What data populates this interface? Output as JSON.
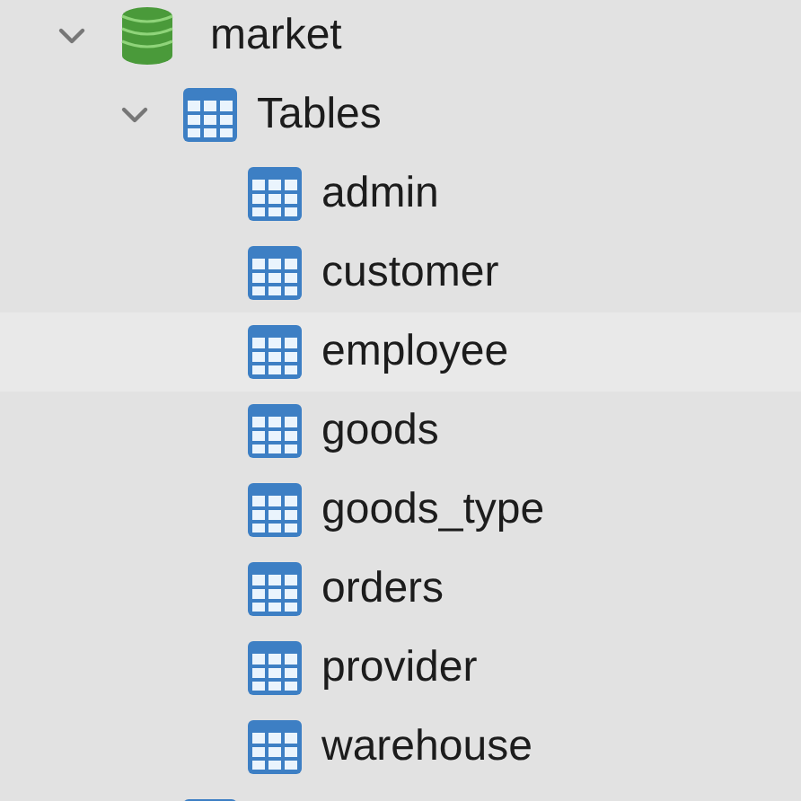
{
  "tree": [
    {
      "kind": "database",
      "label": "market",
      "expanded": true,
      "children": [
        {
          "kind": "table",
          "label": "Tables",
          "expanded": true,
          "children": [
            {
              "kind": "table",
              "label": "admin",
              "selected": false
            },
            {
              "kind": "table",
              "label": "customer",
              "selected": false
            },
            {
              "kind": "table",
              "label": "employee",
              "selected": true
            },
            {
              "kind": "table",
              "label": "goods",
              "selected": false
            },
            {
              "kind": "table",
              "label": "goods_type",
              "selected": false
            },
            {
              "kind": "table",
              "label": "orders",
              "selected": false
            },
            {
              "kind": "table",
              "label": "provider",
              "selected": false
            },
            {
              "kind": "table",
              "label": "warehouse",
              "selected": false
            }
          ]
        },
        {
          "kind": "table"
        }
      ]
    }
  ]
}
